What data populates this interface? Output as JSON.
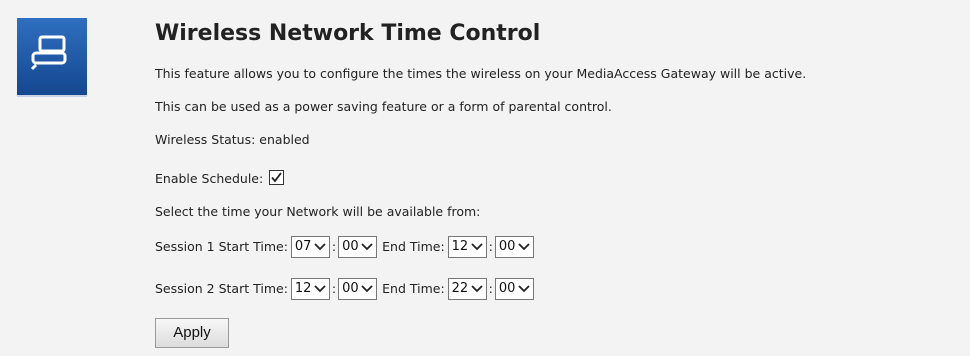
{
  "page": {
    "title": "Wireless Network Time Control",
    "description_1": "This feature allows you to configure the times the wireless on your MediaAccess Gateway will be active.",
    "description_2": "This can be used as a power saving feature or a form of parental control.",
    "wireless_status": "Wireless Status: enabled",
    "enable_schedule_label": "Enable Schedule:",
    "enable_schedule_checked": true,
    "select_time_text": "Select the time your Network will be available from:",
    "apply_label": "Apply"
  },
  "sessions": [
    {
      "start_label": "Session 1 Start Time:",
      "start_hour": "07",
      "start_minute": "00",
      "end_label": "End Time:",
      "end_hour": "12",
      "end_minute": "00"
    },
    {
      "start_label": "Session 2 Start Time:",
      "start_hour": "12",
      "start_minute": "00",
      "end_label": "End Time:",
      "end_hour": "22",
      "end_minute": "00"
    }
  ],
  "icons": {
    "logo": "network-device-icon",
    "dropdown": "chevron-down-icon",
    "checkbox": "checkmark-icon"
  },
  "colors": {
    "background": "#f3f3f3",
    "logo_tile": "#1f5aa8"
  }
}
